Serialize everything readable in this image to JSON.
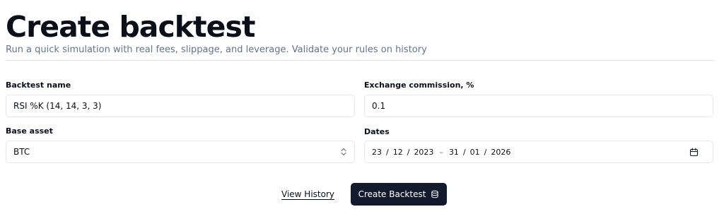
{
  "header": {
    "title": "Create backtest",
    "subtitle": "Run a quick simulation with real fees, slippage, and leverage. Validate your rules on history"
  },
  "form": {
    "backtest_name": {
      "label": "Backtest name",
      "value": "RSI %K (14, 14, 3, 3)"
    },
    "commission": {
      "label": "Exchange commission, %",
      "value": "0.1"
    },
    "base_asset": {
      "label": "Base asset",
      "value": "BTC"
    },
    "dates": {
      "label": "Dates",
      "start": {
        "day": "23",
        "month": "12",
        "year": "2023"
      },
      "end": {
        "day": "31",
        "month": "01",
        "year": "2026"
      },
      "date_separator": "/",
      "range_separator": "–"
    }
  },
  "actions": {
    "view_history": "View History",
    "create_backtest": "Create Backtest"
  },
  "icons": {
    "select": "chevron-up-down-icon",
    "calendar": "calendar-icon",
    "create": "database-icon"
  },
  "colors": {
    "primary_button": "#121a2c",
    "border": "#e5e7eb",
    "muted_text": "#64748b"
  }
}
